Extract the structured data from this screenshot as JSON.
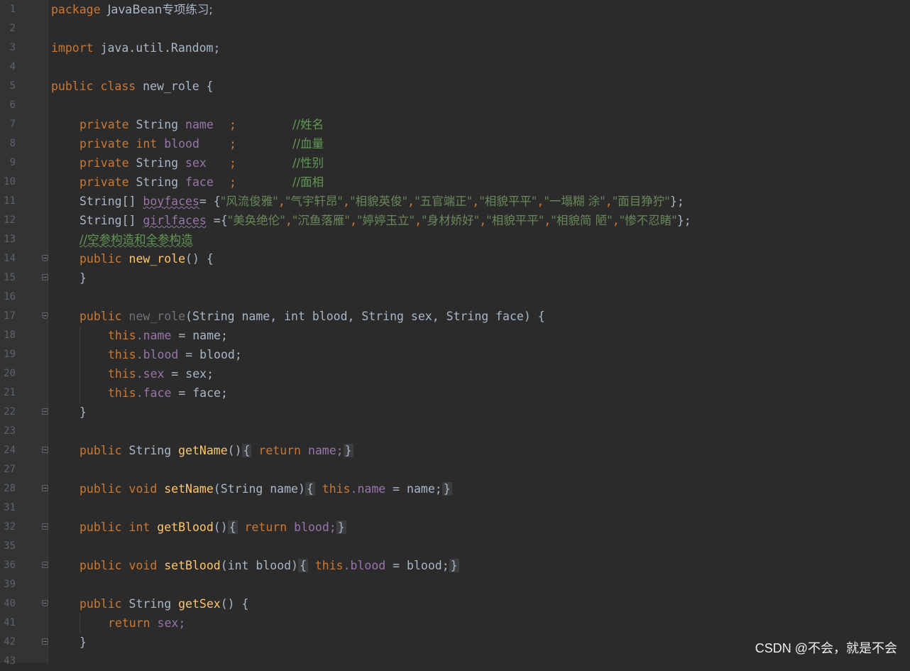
{
  "editor": {
    "line_numbers": [
      "1",
      "2",
      "3",
      "4",
      "5",
      "6",
      "7",
      "8",
      "9",
      "10",
      "11",
      "12",
      "13",
      "14",
      "15",
      "16",
      "17",
      "18",
      "19",
      "20",
      "21",
      "22",
      "23",
      "24",
      "27",
      "28",
      "31",
      "32",
      "35",
      "36",
      "39",
      "40",
      "41",
      "42",
      "43"
    ],
    "package_kw": "package",
    "package_name": "JavaBean专项练习;",
    "import_kw": "import",
    "import_name": "java.util.Random;",
    "class_decl": {
      "public": "public",
      "class": "class",
      "name": "new_role {"
    },
    "fields": [
      {
        "mod": "private",
        "type": "String",
        "name": "name",
        "semi": ";",
        "comment": "//姓名"
      },
      {
        "mod": "private",
        "type": "int",
        "name": "blood",
        "semi": ";",
        "comment": "//血量"
      },
      {
        "mod": "private",
        "type": "String",
        "name": "sex",
        "semi": ";",
        "comment": "//性别"
      },
      {
        "mod": "private",
        "type": "String",
        "name": "face",
        "semi": ";",
        "comment": "//面相"
      }
    ],
    "boyfaces": {
      "decl": "String[]",
      "name": "boyfaces",
      "assign": "= {",
      "values": [
        "\"风流俊雅\"",
        "\"气宇轩昂\"",
        "\"相貌英俊\"",
        "\"五官端正\"",
        "\"相貌平平\"",
        "\"一塌糊 涂\"",
        "\"面目狰狞\""
      ],
      "end": "};"
    },
    "girlfaces": {
      "decl": "String[]",
      "name": "girlfaces",
      "assign": "={",
      "values": [
        "\"美奂绝伦\"",
        "\"沉鱼落雁\"",
        "\"婷婷玉立\"",
        "\"身材娇好\"",
        "\"相貌平平\"",
        "\"相貌简 陋\"",
        "\"惨不忍睹\""
      ],
      "end": "};"
    },
    "ctor_comment": "//空参构造和全参构造",
    "ctor_empty": {
      "public": "public",
      "name": "new_role",
      "rest": "() {",
      "close": "}"
    },
    "ctor_full": {
      "public": "public",
      "name": "new_role",
      "params": "(String name, int blood, String sex, String face) {",
      "body": [
        {
          "this": "this",
          "field": ".name",
          "rest": " = name;"
        },
        {
          "this": "this",
          "field": ".blood",
          "rest": " = blood;"
        },
        {
          "this": "this",
          "field": ".sex",
          "rest": " = sex;"
        },
        {
          "this": "this",
          "field": ".face",
          "rest": " = face;"
        }
      ],
      "close": "}"
    },
    "getName": {
      "sig": "String",
      "name": "getName",
      "parens": "()",
      "ret": "return",
      "val": "name;"
    },
    "setName": {
      "sig": "void",
      "name": "setName",
      "params": "(String name)",
      "this": "this",
      "field": ".name",
      "rest": " = name;"
    },
    "getBlood": {
      "sig": "int",
      "name": "getBlood",
      "parens": "()",
      "ret": "return",
      "val": "blood;"
    },
    "setBlood": {
      "sig": "void",
      "name": "setBlood",
      "params": "(int blood)",
      "this": "this",
      "field": ".blood",
      "rest": " = blood;"
    },
    "getSex": {
      "sig": "String",
      "name": "getSex",
      "parens": "() {",
      "ret": "return",
      "val": "sex;",
      "close": "}"
    }
  },
  "watermark": "CSDN @不会，就是不会 "
}
